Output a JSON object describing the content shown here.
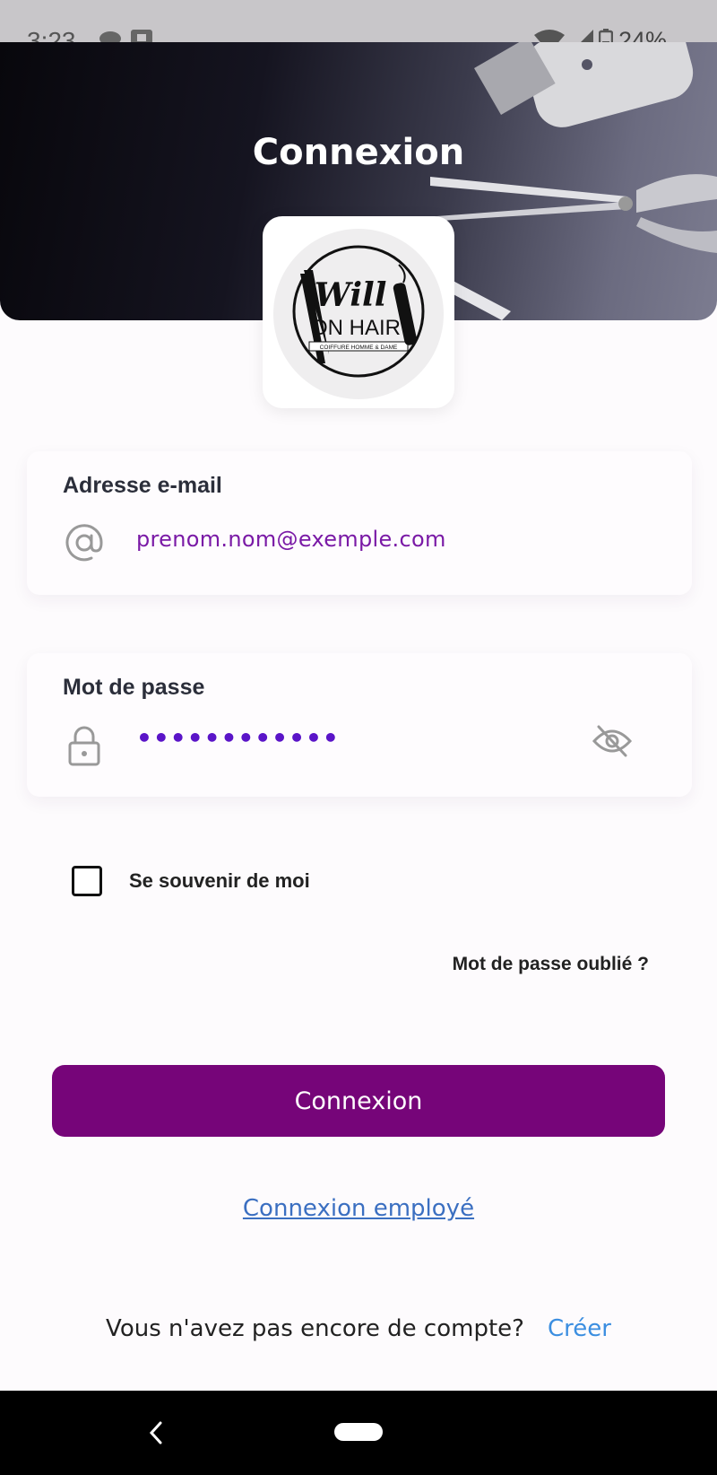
{
  "status_bar": {
    "time": "3:23",
    "battery": "24%"
  },
  "header": {
    "title": "Connexion"
  },
  "logo": {
    "line1": "Will",
    "line2": "ON HAIR",
    "tagline": "• COIFFURE HOMME & DAME •"
  },
  "email": {
    "label": "Adresse e-mail",
    "value": "prenom.nom@exemple.com",
    "icon": "at-icon"
  },
  "password": {
    "label": "Mot de passe",
    "value": "••••••••••••",
    "icon": "lock-icon",
    "toggle_icon": "eye-off-icon"
  },
  "remember": {
    "label": "Se souvenir de moi",
    "checked": false
  },
  "forgot_label": "Mot de passe oublié ?",
  "login_button": "Connexion",
  "employee_link": "Connexion employé",
  "signup": {
    "text": "Vous n'avez pas encore de compte?",
    "link": "Créer"
  },
  "colors": {
    "primary": "#760579",
    "link": "#3b8ee0",
    "input_text": "#7a1aa6"
  }
}
